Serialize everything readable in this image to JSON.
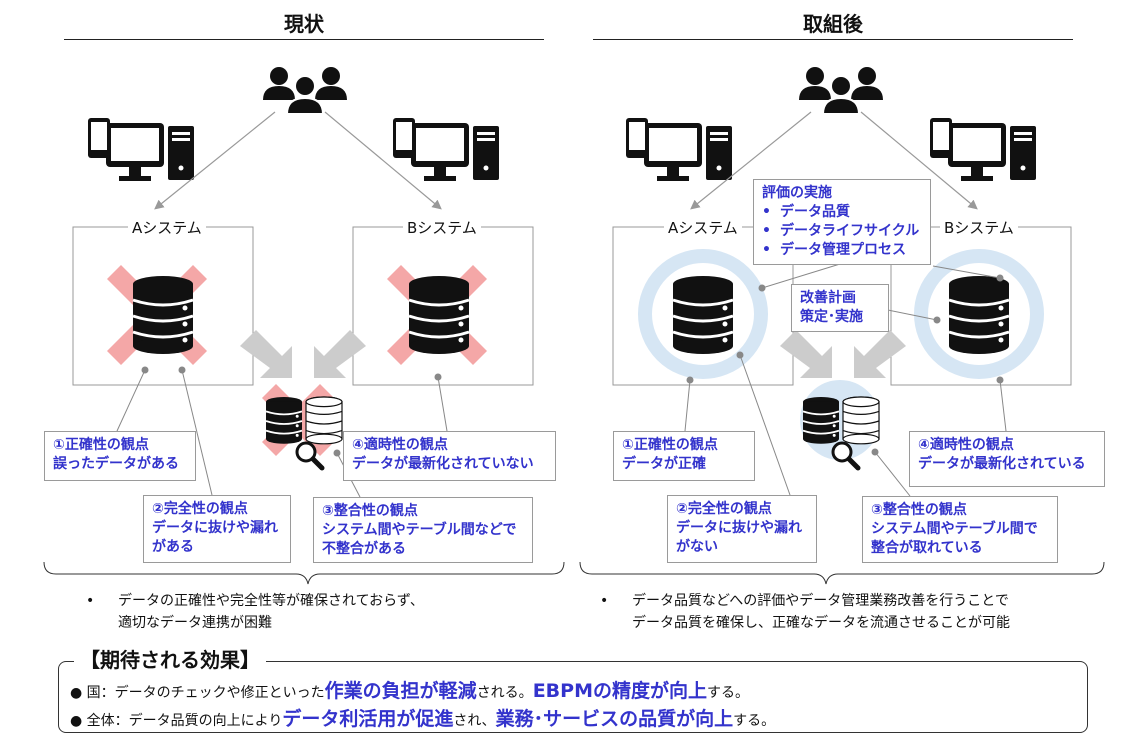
{
  "left": {
    "title": "現状",
    "system_a": "Aシステム",
    "system_b": "Bシステム",
    "c1": {
      "line1": "①正確性の観点",
      "line2": "誤ったデータがある"
    },
    "c2": {
      "line1": "②完全性の観点",
      "line2": "データに抜けや漏れ",
      "line3": "がある"
    },
    "c3": {
      "line1": "③整合性の観点",
      "line2": "システム間やテーブル間などで",
      "line3": "不整合がある"
    },
    "c4": {
      "line1": "④適時性の観点",
      "line2": "データが最新化されていない"
    },
    "note": {
      "line1": "データの正確性や完全性等が確保されておらず、",
      "line2": "適切なデータ連携が困難"
    }
  },
  "right": {
    "title": "取組後",
    "system_a": "Aシステム",
    "system_b": "Bシステム",
    "eval": {
      "title": "評価の実施",
      "items": [
        "データ品質",
        "データライフサイクル",
        "データ管理プロセス"
      ]
    },
    "plan": {
      "line1": "改善計画",
      "line2": "策定･実施"
    },
    "c1": {
      "line1": "①正確性の観点",
      "line2": "データが正確"
    },
    "c2": {
      "line1": "②完全性の観点",
      "line2": "データに抜けや漏れ",
      "line3": "がない"
    },
    "c3": {
      "line1": "③整合性の観点",
      "line2": "システム間やテーブル間で",
      "line3": "整合が取れている"
    },
    "c4": {
      "line1": "④適時性の観点",
      "line2": "データが最新化されている"
    },
    "note": {
      "line1": "データ品質などへの評価やデータ管理業務改善を行うことで",
      "line2": "データ品質を確保し、正確なデータを流通させることが可能"
    }
  },
  "effects": {
    "title": "【期待される効果】",
    "line1": {
      "prefix": "国：データのチェックや修正といった",
      "bold1": "作業の負担が軽減",
      "mid1": "される。",
      "bold2": "EBPMの精度が向上",
      "suffix": "する。"
    },
    "line2": {
      "prefix": "全体：データ品質の向上により",
      "bold1": "データ利活用が促進",
      "mid1": "され、",
      "bold2": "業務･サービスの品質が向上",
      "suffix": "する。"
    }
  },
  "colors": {
    "accent": "#3333cc",
    "cross": "#f4a7a7",
    "ring": "#d6e6f4",
    "arrow": "#cccccc"
  },
  "icons": [
    "users-icon",
    "pc-icon",
    "database-icon",
    "magnifier-icon",
    "cross-mark"
  ]
}
